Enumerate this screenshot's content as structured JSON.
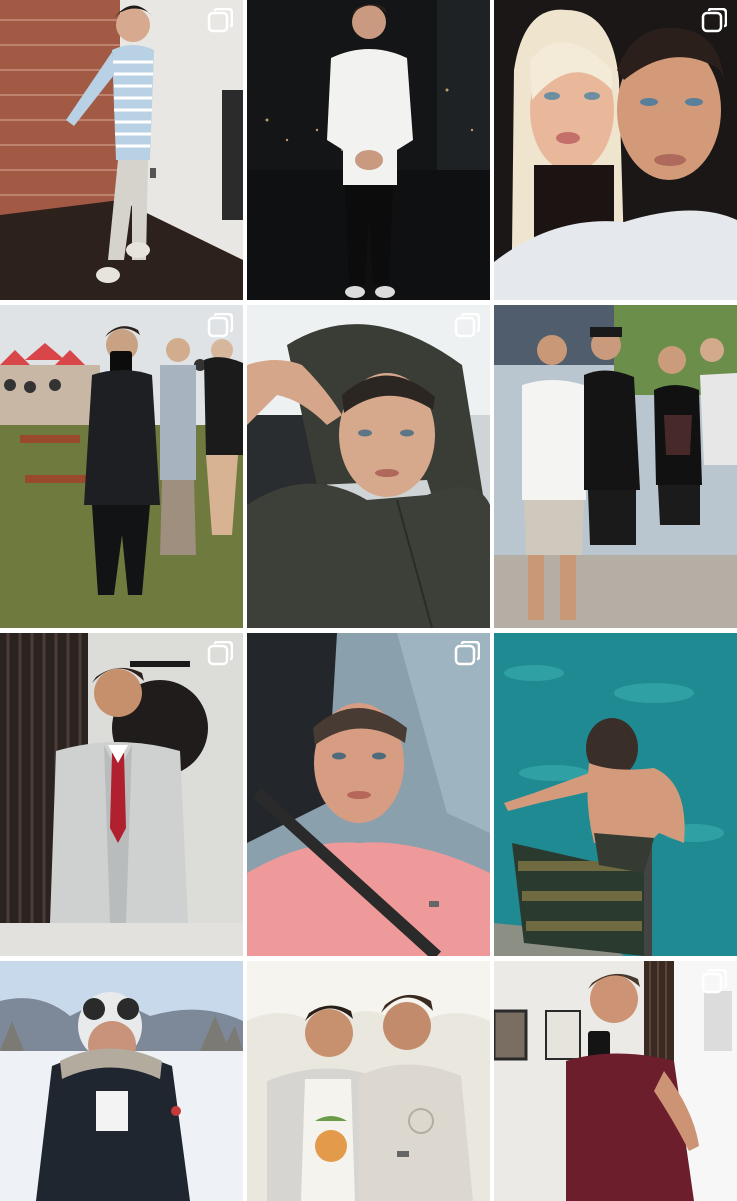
{
  "grid": {
    "posts": [
      {
        "id": "post-1",
        "multi": true,
        "alt": ""
      },
      {
        "id": "post-2",
        "multi": false,
        "alt": ""
      },
      {
        "id": "post-3",
        "multi": true,
        "alt": ""
      },
      {
        "id": "post-4",
        "multi": true,
        "alt": ""
      },
      {
        "id": "post-5",
        "multi": true,
        "alt": ""
      },
      {
        "id": "post-6",
        "multi": false,
        "alt": ""
      },
      {
        "id": "post-7",
        "multi": true,
        "alt": ""
      },
      {
        "id": "post-8",
        "multi": true,
        "alt": ""
      },
      {
        "id": "post-9",
        "multi": false,
        "alt": ""
      },
      {
        "id": "post-10",
        "multi": false,
        "alt": ""
      },
      {
        "id": "post-11",
        "multi": false,
        "alt": ""
      },
      {
        "id": "post-12",
        "multi": true,
        "alt": ""
      }
    ],
    "icons": {
      "multi": "carousel-stack-icon"
    }
  }
}
